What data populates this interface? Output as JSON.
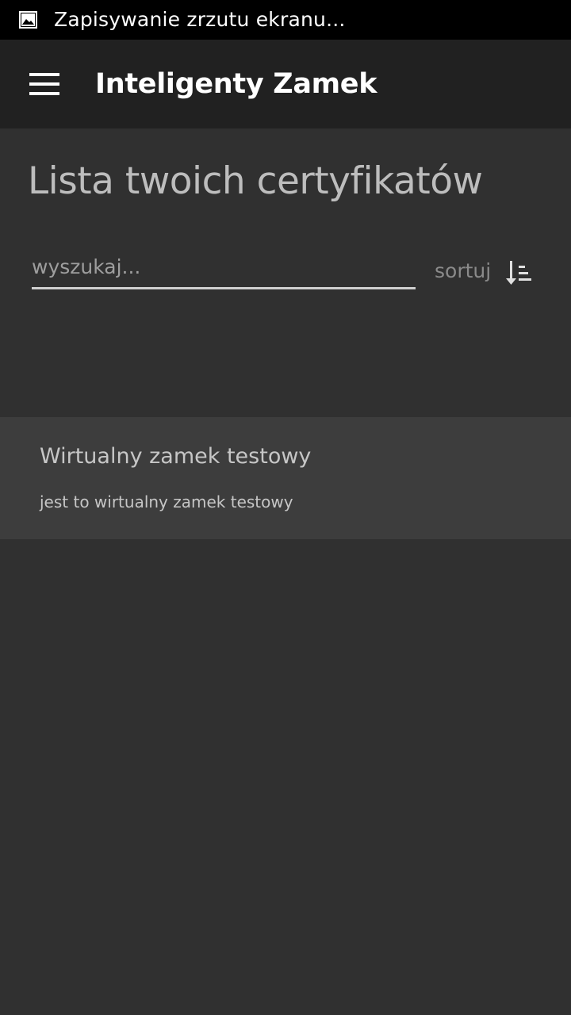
{
  "status_bar": {
    "notification_icon": "image-icon",
    "text": "Zapisywanie zrzutu ekranu..."
  },
  "app_bar": {
    "menu_icon": "hamburger-menu-icon",
    "title": "Inteligenty Zamek"
  },
  "main": {
    "page_title": "Lista twoich certyfikatów",
    "search": {
      "placeholder": "wyszukaj...",
      "value": ""
    },
    "sort": {
      "label": "sortuj",
      "icon": "sort-ascending-icon"
    },
    "certificates": [
      {
        "title": "Wirtualny zamek testowy",
        "description": "jest to wirtualny zamek testowy"
      }
    ]
  },
  "colors": {
    "status_bar_bg": "#000000",
    "app_bar_bg": "#212121",
    "content_bg": "#303030",
    "list_item_bg": "#3d3d3d",
    "title_text": "#ffffff",
    "secondary_text": "#bdbdbd"
  }
}
